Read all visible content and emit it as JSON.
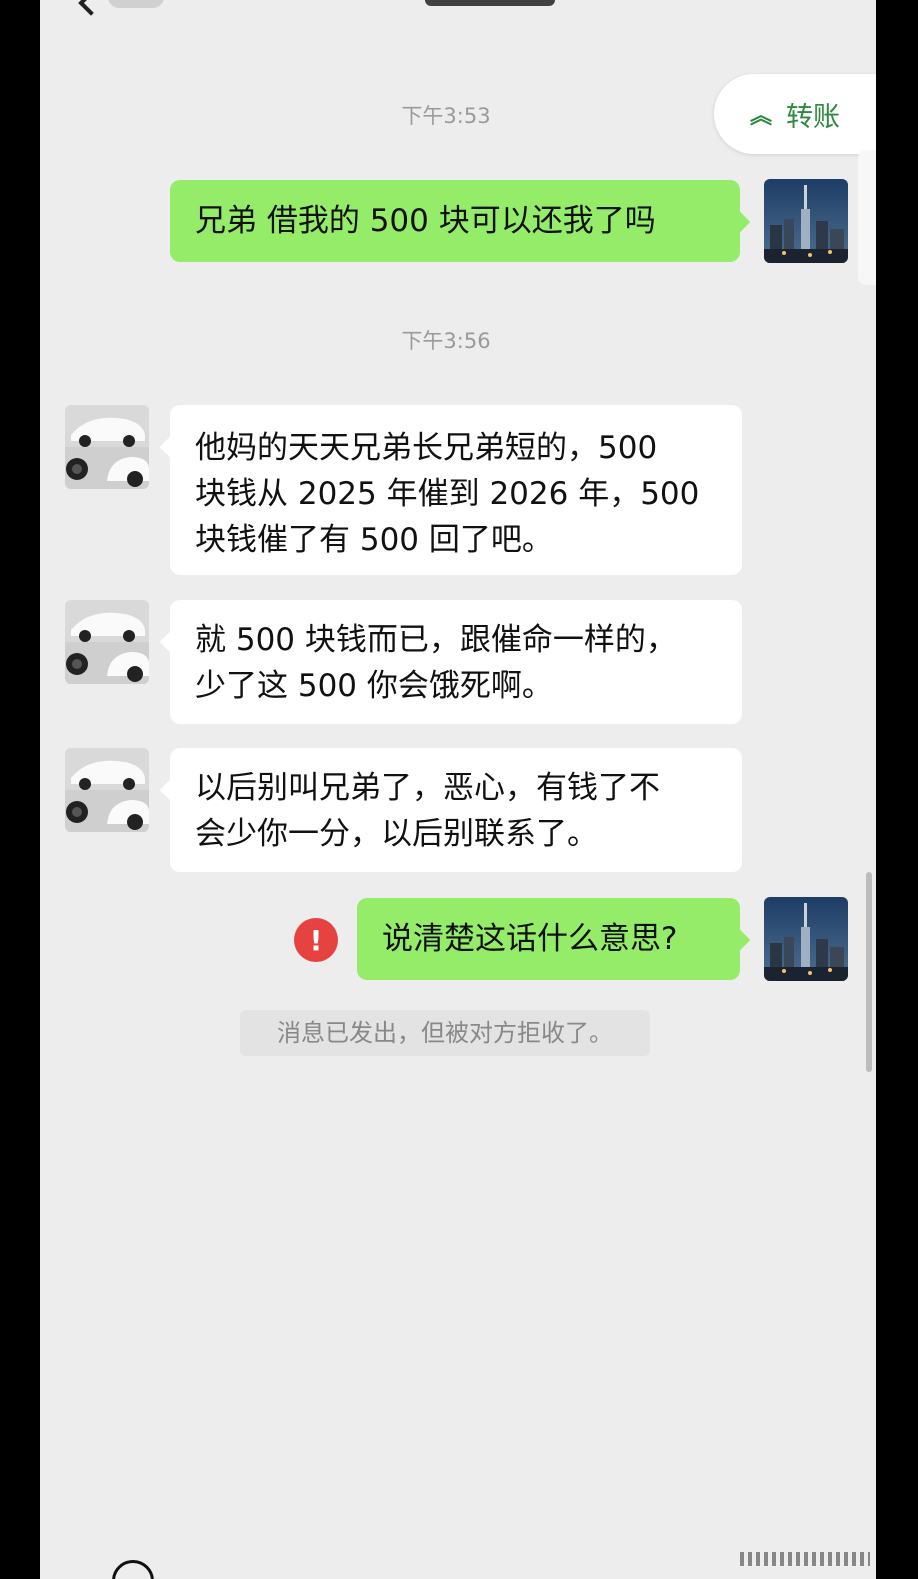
{
  "chat": {
    "header_title": "",
    "transfer_button": {
      "icon": "chevron-up-icon",
      "label": "转账"
    },
    "messages": [
      {
        "type": "time",
        "text": "下午3:53"
      },
      {
        "type": "message",
        "side": "me",
        "text": "兄弟 借我的 500 块可以还我了吗",
        "avatar": "city-skyline-avatar"
      },
      {
        "type": "time",
        "text": "下午3:56"
      },
      {
        "type": "message",
        "side": "other",
        "lines": [
          "他妈的天天兄弟长兄弟短的，500",
          "块钱从 2025 年催到 2026 年，500",
          "块钱催了有 500 回了吧。"
        ],
        "avatar": "white-car-avatar"
      },
      {
        "type": "message",
        "side": "other",
        "lines": [
          "就 500 块钱而已，跟催命一样的，",
          "少了这 500 你会饿死啊。"
        ],
        "avatar": "white-car-avatar"
      },
      {
        "type": "message",
        "side": "other",
        "lines": [
          "以后别叫兄弟了，恶心，有钱了不",
          "会少你一分，以后别联系了。"
        ],
        "avatar": "white-car-avatar"
      },
      {
        "type": "message",
        "side": "me",
        "text": "说清楚这话什么意思?",
        "status": "failed",
        "status_icon": "!",
        "avatar": "city-skyline-avatar"
      },
      {
        "type": "system",
        "text": "消息已发出，但被对方拒收了。"
      }
    ]
  },
  "colors": {
    "me_bubble": "#95ec69",
    "other_bubble": "#ffffff",
    "error": "#e64340",
    "accent_green": "#2b8a3e",
    "background": "#ededed"
  }
}
